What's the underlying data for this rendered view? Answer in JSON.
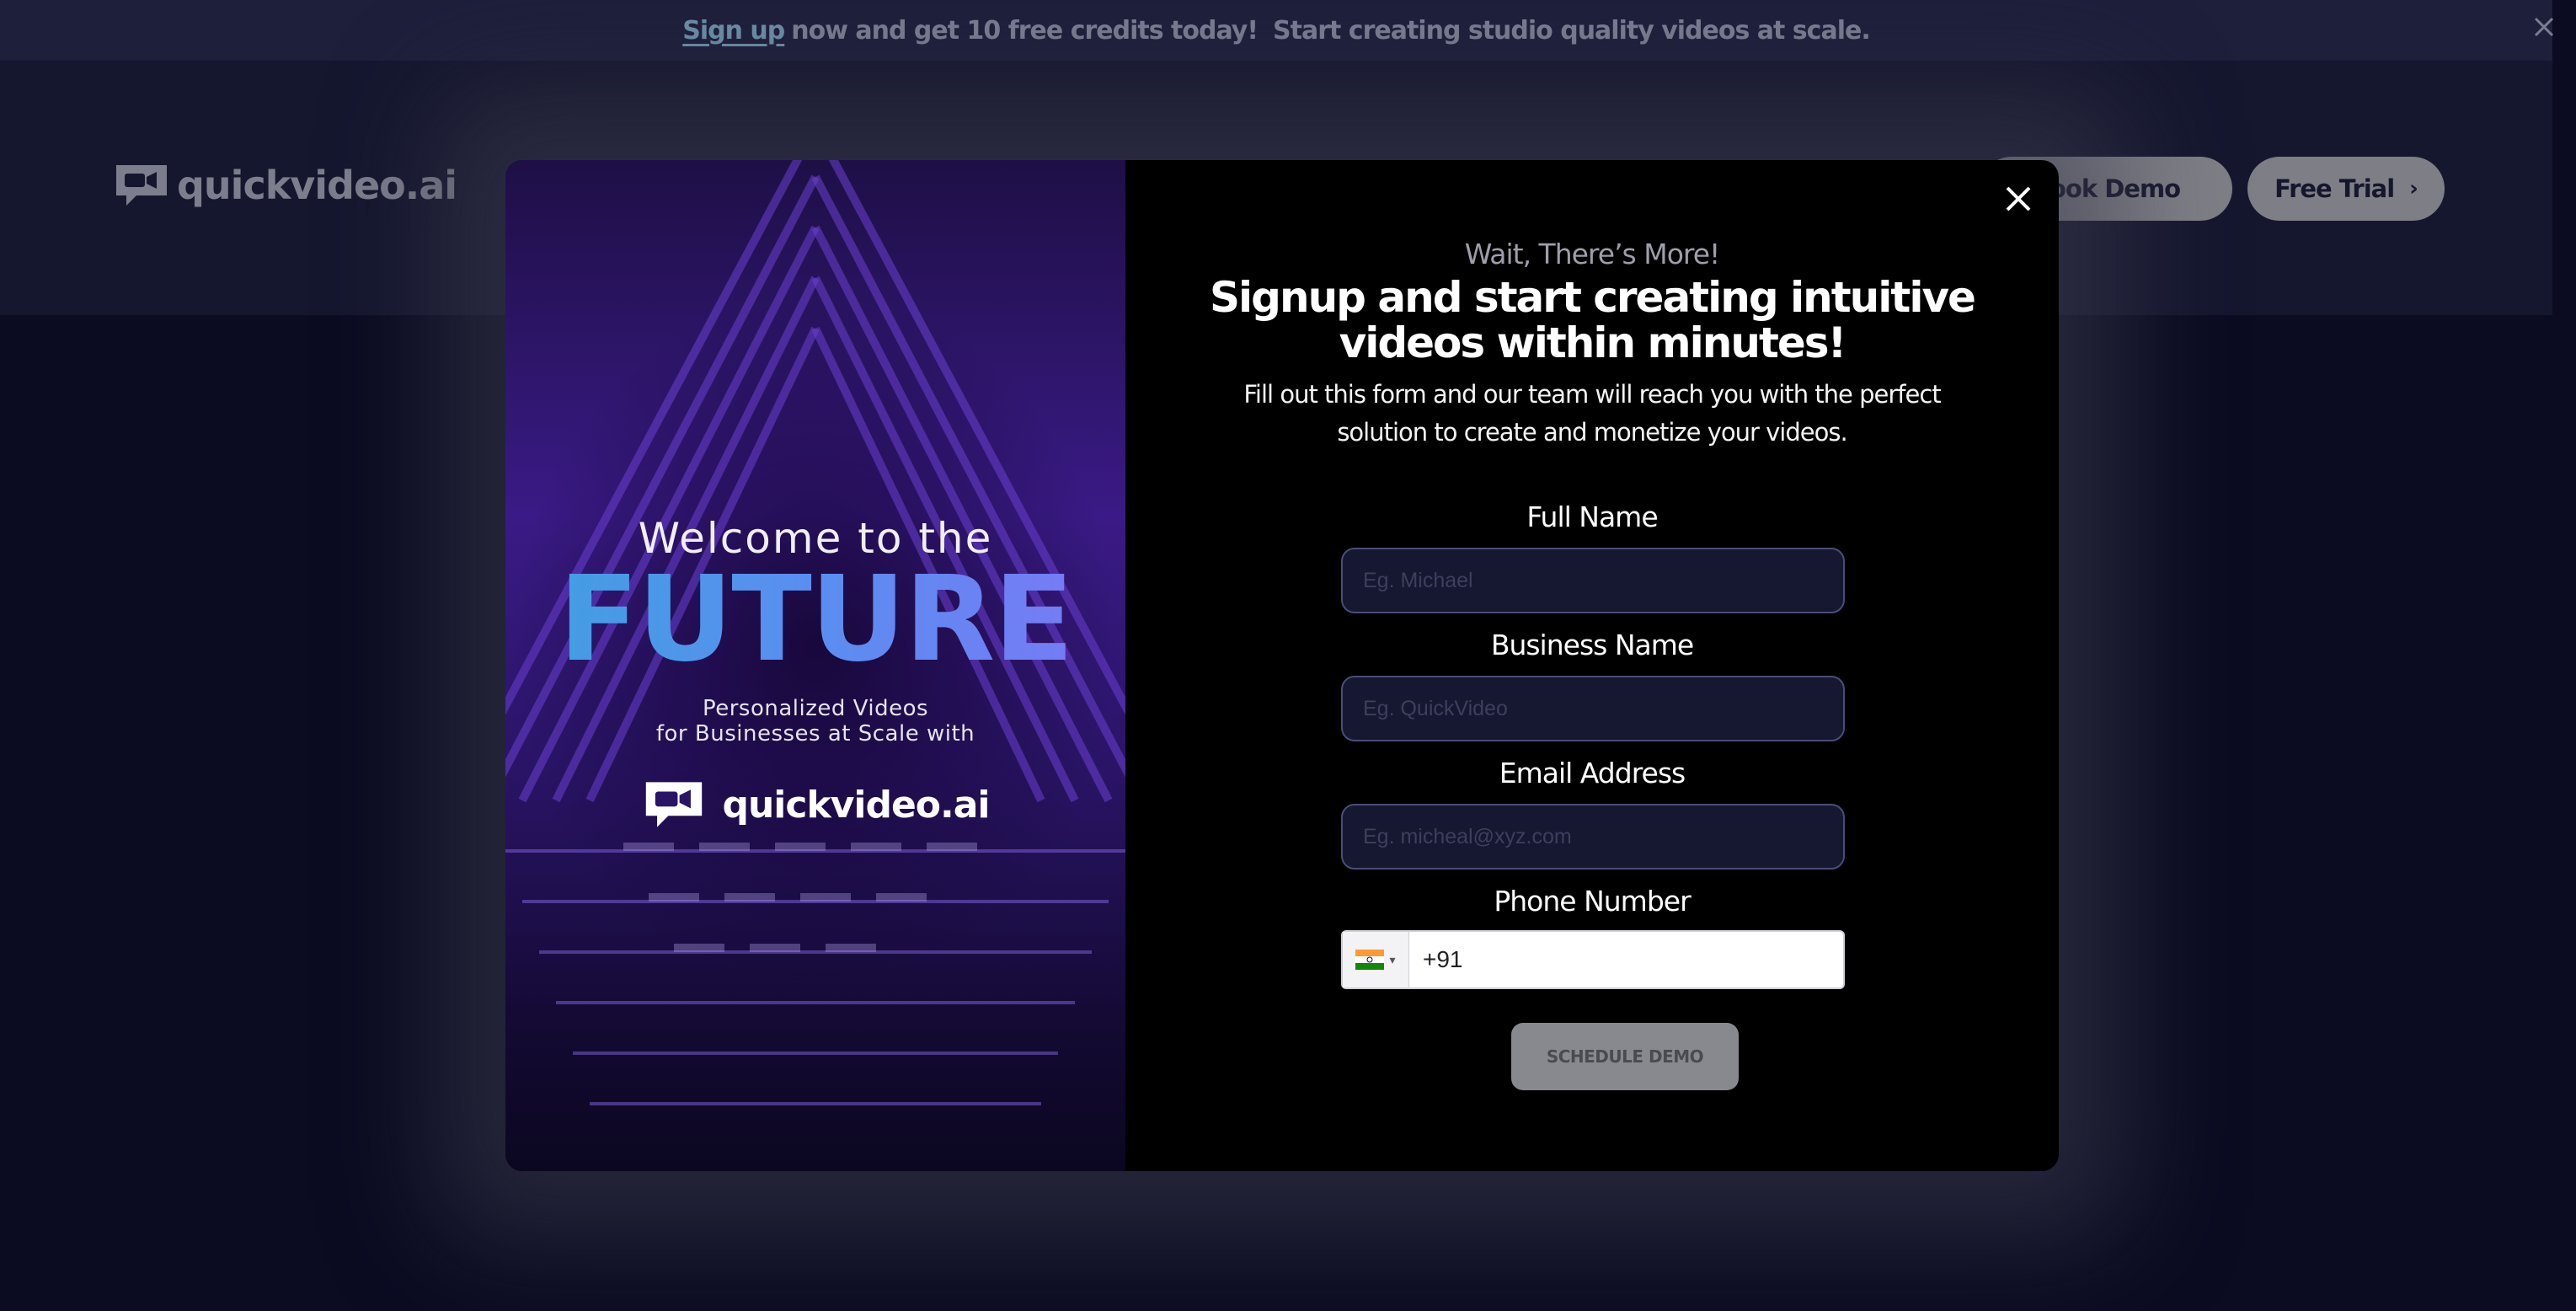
{
  "announcement": {
    "link_text": "Sign up",
    "message_1": "now and get 10 free credits today!",
    "message_2": "Start creating studio quality videos at scale.",
    "close_icon": "close-icon"
  },
  "header": {
    "logo_text": "quickvideo.ai",
    "book_demo_label": "Book Demo",
    "free_trial_label": "Free Trial",
    "free_trial_chevron": "›"
  },
  "modal": {
    "promo": {
      "welcome": "Welcome to the",
      "future": "FUTURE",
      "sub_line_1": "Personalized Videos",
      "sub_line_2": "for Businesses at Scale with",
      "logo_text": "quickvideo.ai"
    },
    "kicker": "Wait, There’s More!",
    "headline": "Signup and start creating intuitive videos within minutes!",
    "description": "Fill out this form and our team will reach you with the perfect solution to create and monetize your videos.",
    "form": {
      "full_name": {
        "label": "Full Name",
        "value": "",
        "placeholder": "Eg. Michael"
      },
      "business_name": {
        "label": "Business Name",
        "value": "",
        "placeholder": "Eg. QuickVideo"
      },
      "email": {
        "label": "Email Address",
        "value": "",
        "placeholder": "Eg. micheal@xyz.com"
      },
      "phone": {
        "label": "Phone Number",
        "country": "India",
        "value": "+91"
      },
      "submit_label": "SCHEDULE DEMO"
    }
  },
  "colors": {
    "page_bg": "#0b0c22",
    "announce_bg": "#1d1f3b",
    "header_bg": "#15172f",
    "accent_blue": "#3fa1e0",
    "input_bg": "#161832",
    "input_border": "#4a4c78"
  }
}
